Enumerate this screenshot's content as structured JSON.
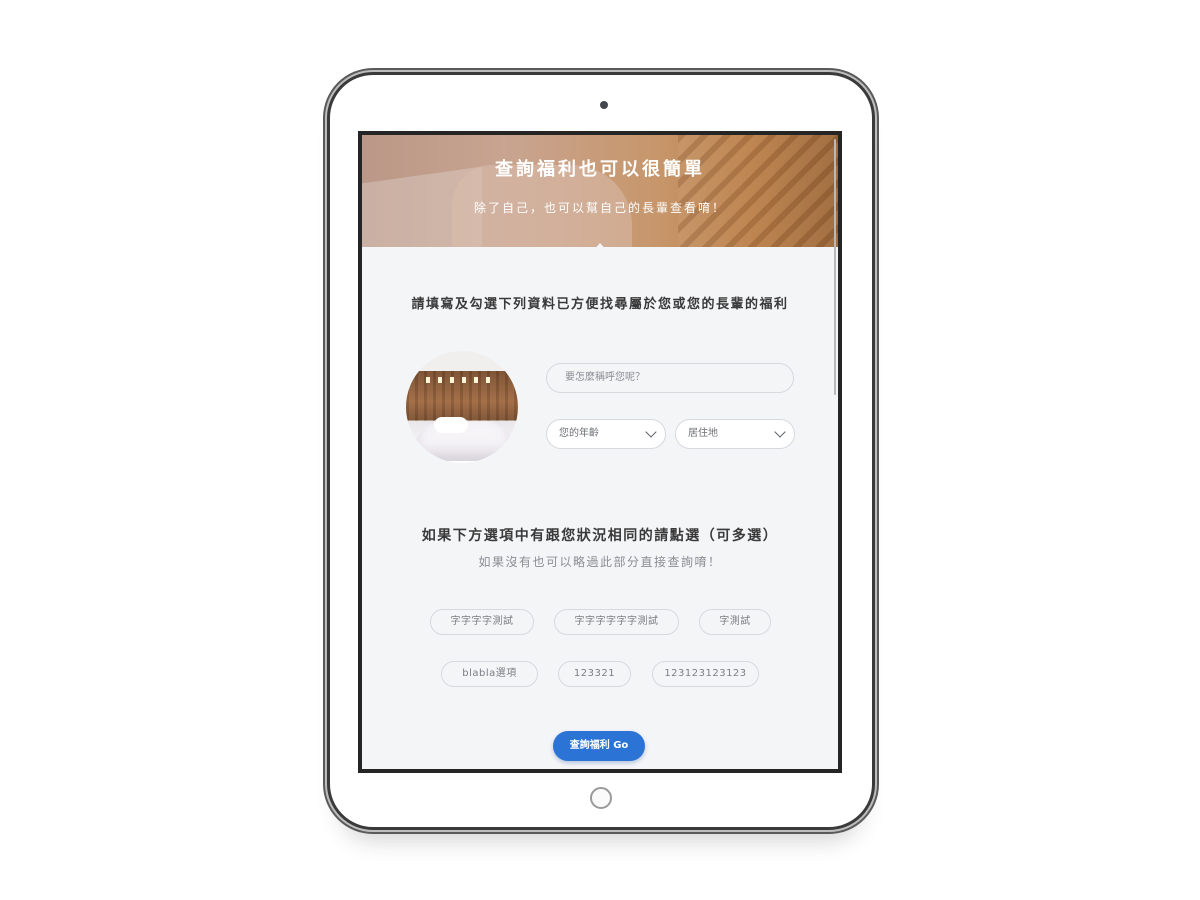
{
  "hero": {
    "title": "查詢福利也可以很簡單",
    "subtitle": "除了自己，也可以幫自己的長輩查看唷！"
  },
  "form": {
    "heading": "請填寫及勾選下列資料已方便找尋屬於您或您的長輩的福利",
    "name_placeholder": "要怎麼稱呼您呢？",
    "age_select": "您的年齡",
    "location_select": "居住地"
  },
  "options": {
    "heading": "如果下方選項中有跟您狀況相同的請點選（可多選）",
    "subheading": "如果沒有也可以略過此部分直接查詢唷！",
    "chips": [
      "字字字字測試",
      "字字字字字字測試",
      "字測試",
      "blabla選項",
      "123321",
      "123123123123"
    ]
  },
  "submit": {
    "label": "查詢福利 Go"
  },
  "colors": {
    "primary": "#2b74d6",
    "background": "#f4f5f7",
    "text": "#3a3a3a"
  }
}
